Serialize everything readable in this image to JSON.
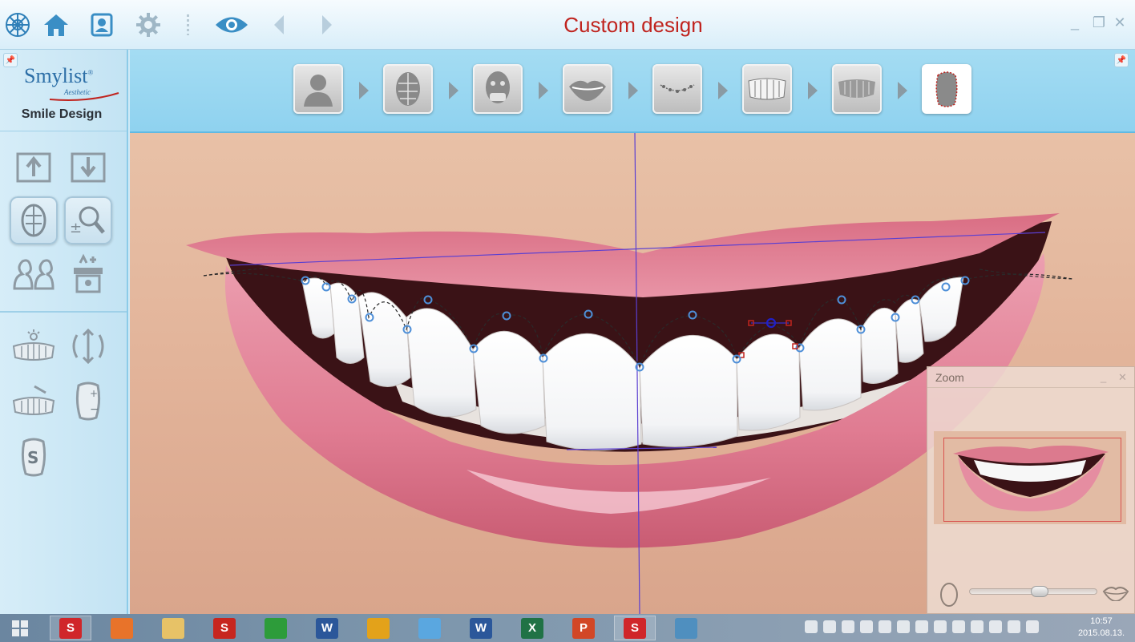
{
  "window": {
    "title": "Custom design",
    "minimize": "_",
    "maximize": "❐",
    "close": "✕"
  },
  "toolbar": {
    "icons": [
      "snowflake-menu-icon",
      "home-icon",
      "patient-card-icon",
      "gear-icon",
      "eye-icon",
      "back-arrow-icon",
      "forward-arrow-icon"
    ]
  },
  "sidebar": {
    "logo_name": "Smylist",
    "logo_registered": "®",
    "logo_sub": "Aesthetic",
    "caption": "Smile Design",
    "tools": [
      "import-image-icon",
      "export-image-icon",
      "facial-midline-icon",
      "zoom-tool-icon",
      "compare-faces-icon",
      "library-transfer-icon",
      "teeth-lighting-icon",
      "rotate-resize-icon",
      "teeth-shaping-icon",
      "add-remove-tooth-icon",
      "smylist-s-icon"
    ]
  },
  "steps": [
    {
      "name": "face-silhouette-step"
    },
    {
      "name": "face-grid-step"
    },
    {
      "name": "face-mask-step"
    },
    {
      "name": "lips-step"
    },
    {
      "name": "lip-points-step"
    },
    {
      "name": "teeth-outline-step"
    },
    {
      "name": "teeth-step"
    },
    {
      "name": "custom-tooth-step",
      "current": true
    }
  ],
  "zoom": {
    "title": "Zoom",
    "minimize": "_",
    "close": "✕",
    "level": 0.55
  },
  "taskbar": {
    "apps": [
      {
        "label": "S",
        "color": "#d0262a",
        "name": "smylist-taskbar-icon"
      },
      {
        "label": "",
        "color": "#e8732a",
        "name": "firefox-icon"
      },
      {
        "label": "",
        "color": "#e7c267",
        "name": "file-explorer-icon"
      },
      {
        "label": "S",
        "color": "#c7261f",
        "name": "smylist-s-taskbar-icon"
      },
      {
        "label": "",
        "color": "#2d9c3a",
        "name": "store-icon"
      },
      {
        "label": "W",
        "color": "#2b579a",
        "name": "word-icon"
      },
      {
        "label": "",
        "color": "#e3a21a",
        "name": "chrome-icon"
      },
      {
        "label": "",
        "color": "#5aa7e0",
        "name": "picasa-icon"
      },
      {
        "label": "W",
        "color": "#2b579a",
        "name": "word-icon-2"
      },
      {
        "label": "X",
        "color": "#207245",
        "name": "excel-icon"
      },
      {
        "label": "P",
        "color": "#d24726",
        "name": "powerpoint-icon"
      },
      {
        "label": "S",
        "color": "#d0262a",
        "name": "smylist-active-icon"
      },
      {
        "label": "",
        "color": "#4f8fbf",
        "name": "photo-viewer-icon"
      }
    ],
    "clock_time": "10:57",
    "clock_date": "2015.08.13."
  }
}
